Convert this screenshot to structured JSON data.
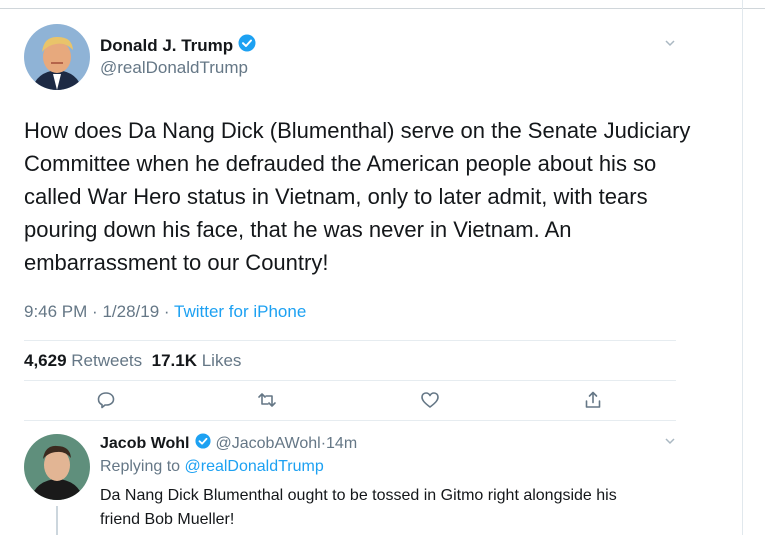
{
  "tweet": {
    "author": {
      "display_name": "Donald J. Trump",
      "handle": "@realDonaldTrump",
      "verified": true
    },
    "text": "How does Da Nang Dick (Blumenthal) serve on the Senate Judiciary Committee when he defrauded the American people about his so called War Hero status in Vietnam, only to later admit, with tears pouring down his face, that he was never in Vietnam. An embarrassment to our Country!",
    "time": "9:46 PM",
    "date": "1/28/19",
    "separator": "·",
    "source": "Twitter for iPhone",
    "retweets": "4,629",
    "retweets_label": "Retweets",
    "likes": "17.1K",
    "likes_label": "Likes"
  },
  "reply": {
    "author": {
      "display_name": "Jacob Wohl",
      "handle": "@JacobAWohl",
      "verified": true
    },
    "separator": "·",
    "time": "14m",
    "replying_prefix": "Replying to",
    "replying_to": "@realDonaldTrump",
    "text": "Da Nang Dick Blumenthal ought to be tossed in Gitmo right alongside his friend Bob Mueller!"
  },
  "icons": {
    "verified": "verified-badge-icon",
    "menu": "chevron-down-icon",
    "reply": "reply-icon",
    "retweet": "retweet-icon",
    "like": "heart-icon",
    "share": "share-icon"
  },
  "colors": {
    "accent": "#1da1f2",
    "text": "#14171a",
    "secondary": "#657786",
    "divider": "#e6ecf0"
  }
}
